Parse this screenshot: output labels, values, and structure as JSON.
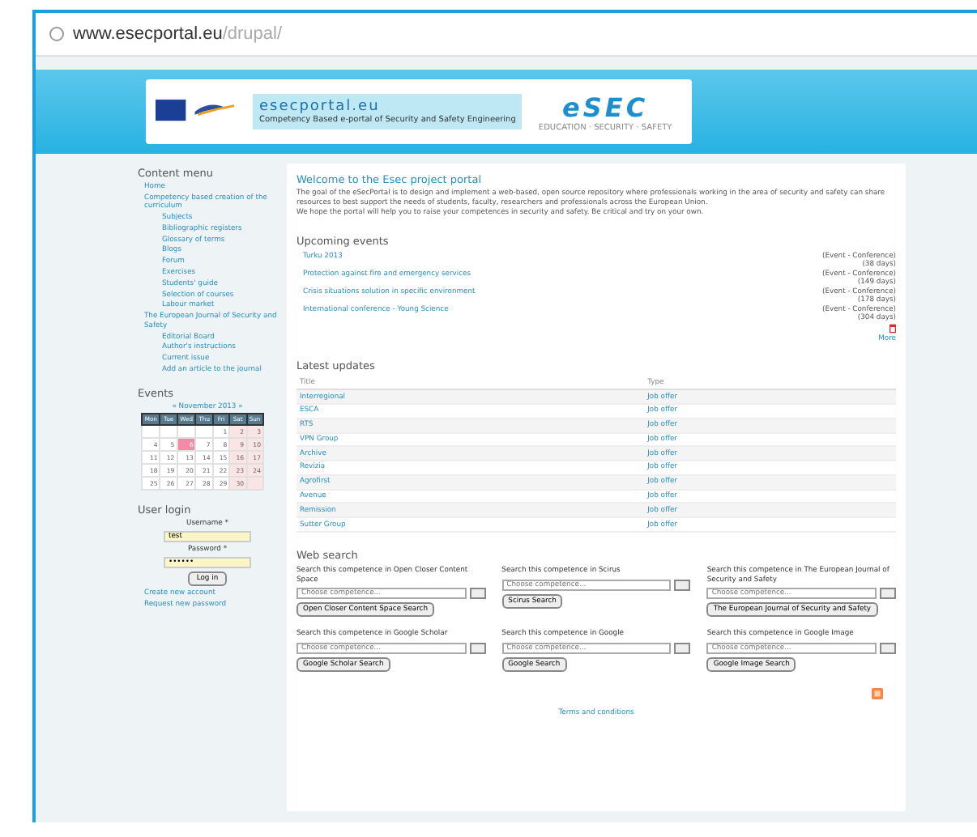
{
  "browser": {
    "url_host": "www.esecportal.eu",
    "url_path": "/drupal/"
  },
  "header": {
    "portal_name": "esecportal.eu",
    "portal_subtitle": "Competency Based e-portal of Security and Safety Engineering",
    "logo_text": "eSEC",
    "logo_tagline": "EDUCATION · SECURITY · SAFETY"
  },
  "content_menu": {
    "title": "Content menu",
    "items": [
      {
        "label": "Home"
      },
      {
        "label": "Competency based creation of the curriculum",
        "children": [
          {
            "label": "Subjects"
          },
          {
            "label": "Bibliographic registers"
          },
          {
            "label": "Glossary of terms"
          },
          {
            "label": "Blogs"
          },
          {
            "label": "Forum"
          },
          {
            "label": "Exercises"
          },
          {
            "label": "Students' guide"
          },
          {
            "label": "Selection of courses"
          },
          {
            "label": "Labour market"
          }
        ]
      },
      {
        "label": "The European Journal of Security and Safety",
        "children": [
          {
            "label": "Editorial Board"
          },
          {
            "label": "Author's instructions"
          },
          {
            "label": "Current issue"
          },
          {
            "label": "Add an article to the journal"
          }
        ]
      }
    ]
  },
  "events": {
    "title": "Events",
    "month": "« November 2013 »",
    "weekdays": [
      "Mon",
      "Tue",
      "Wed",
      "Thu",
      "Fri",
      "Sat",
      "Sun"
    ],
    "weeks": [
      [
        {
          "kind": "blank"
        },
        {
          "kind": "blank"
        },
        {
          "kind": "blank"
        },
        {
          "kind": "blank"
        },
        {
          "day": "1",
          "today": false
        },
        {
          "day": "2",
          "today": false
        },
        {
          "day": "3",
          "today": false
        }
      ],
      [
        {
          "day": "4",
          "today": false
        },
        {
          "day": "5",
          "today": false
        },
        {
          "day": "6",
          "today": true
        },
        {
          "day": "7",
          "today": false
        },
        {
          "day": "8",
          "today": false
        },
        {
          "day": "9",
          "today": false
        },
        {
          "day": "10",
          "today": false
        }
      ],
      [
        {
          "day": "11",
          "today": false
        },
        {
          "day": "12",
          "today": false
        },
        {
          "day": "13",
          "today": false
        },
        {
          "day": "14",
          "today": false
        },
        {
          "day": "15",
          "today": false
        },
        {
          "day": "16",
          "today": false
        },
        {
          "day": "17",
          "today": false
        }
      ],
      [
        {
          "day": "18",
          "today": false
        },
        {
          "day": "19",
          "today": false
        },
        {
          "day": "20",
          "today": false
        },
        {
          "day": "21",
          "today": false
        },
        {
          "day": "22",
          "today": false
        },
        {
          "day": "23",
          "today": false
        },
        {
          "day": "24",
          "today": false
        }
      ],
      [
        {
          "day": "25",
          "today": false
        },
        {
          "day": "26",
          "today": false
        },
        {
          "day": "27",
          "today": false
        },
        {
          "day": "28",
          "today": false
        },
        {
          "day": "29",
          "today": false
        },
        {
          "day": "30",
          "today": false
        },
        {
          "kind": "blank"
        }
      ]
    ]
  },
  "user_login": {
    "title": "User login",
    "username_label": "Username *",
    "username_value": "test",
    "password_label": "Password *",
    "password_value": "••••••",
    "button": "Log in",
    "links": [
      "Create new account",
      "Request new password"
    ]
  },
  "welcome": {
    "title": "Welcome to the Esec project portal",
    "paragraphs": [
      "The goal of the eSecPortal is to design and implement a web-based, open source repository where professionals working in the area of security and safety can share resources to best support the needs of students, faculty, researchers and professionals across the European Union.",
      "We hope the portal will help you to raise your competences in security and safety. Be critical and try on your own."
    ]
  },
  "upcoming_events": {
    "title": "Upcoming events",
    "items": [
      {
        "title": "Turku 2013",
        "type": "(Event - Conference)",
        "days": "(38 days)"
      },
      {
        "title": "Protection against fire and emergency services",
        "type": "(Event - Conference)",
        "days": "(149 days)"
      },
      {
        "title": "Crisis situations solution in specific environment",
        "type": "(Event - Conference)",
        "days": "(178 days)"
      },
      {
        "title": "International conference - Young Science",
        "type": "(Event - Conference)",
        "days": "(304 days)"
      }
    ],
    "more": "More"
  },
  "latest_updates": {
    "title": "Latest updates",
    "columns": [
      "Title",
      "Type"
    ],
    "rows": [
      [
        "Interregional",
        "Job offer"
      ],
      [
        "ESCA",
        "Job offer"
      ],
      [
        "RTS",
        "Job offer"
      ],
      [
        "VPN Group",
        "Job offer"
      ],
      [
        "Archive",
        "Job offer"
      ],
      [
        "Revizia",
        "Job offer"
      ],
      [
        "Agrofirst",
        "Job offer"
      ],
      [
        "Avenue",
        "Job offer"
      ],
      [
        "Remission",
        "Job offer"
      ],
      [
        "Sutter Group",
        "Job offer"
      ]
    ]
  },
  "web_search": {
    "title": "Web search",
    "blocks": [
      {
        "label": "Search this competence in Open Closer Content Space",
        "placeholder": "Choose competence...",
        "button": "Open Closer Content Space Search"
      },
      {
        "label": "Search this competence in Scirus",
        "placeholder": "Choose competence...",
        "button": "Scirus Search"
      },
      {
        "label": "Search this competence in The European Journal of Security and Safety",
        "placeholder": "Choose competence...",
        "button": "The European Journal of Security and Safety"
      },
      {
        "label": "Search this competence in Google Scholar",
        "placeholder": "Choose competence...",
        "button": "Google Scholar Search"
      },
      {
        "label": "Search this competence in Google",
        "placeholder": "Choose competence...",
        "button": "Google Search"
      },
      {
        "label": "Search this competence in Google Image",
        "placeholder": "Choose competence...",
        "button": "Google Image Search"
      }
    ]
  },
  "footer": {
    "link": "Terms and conditions"
  }
}
